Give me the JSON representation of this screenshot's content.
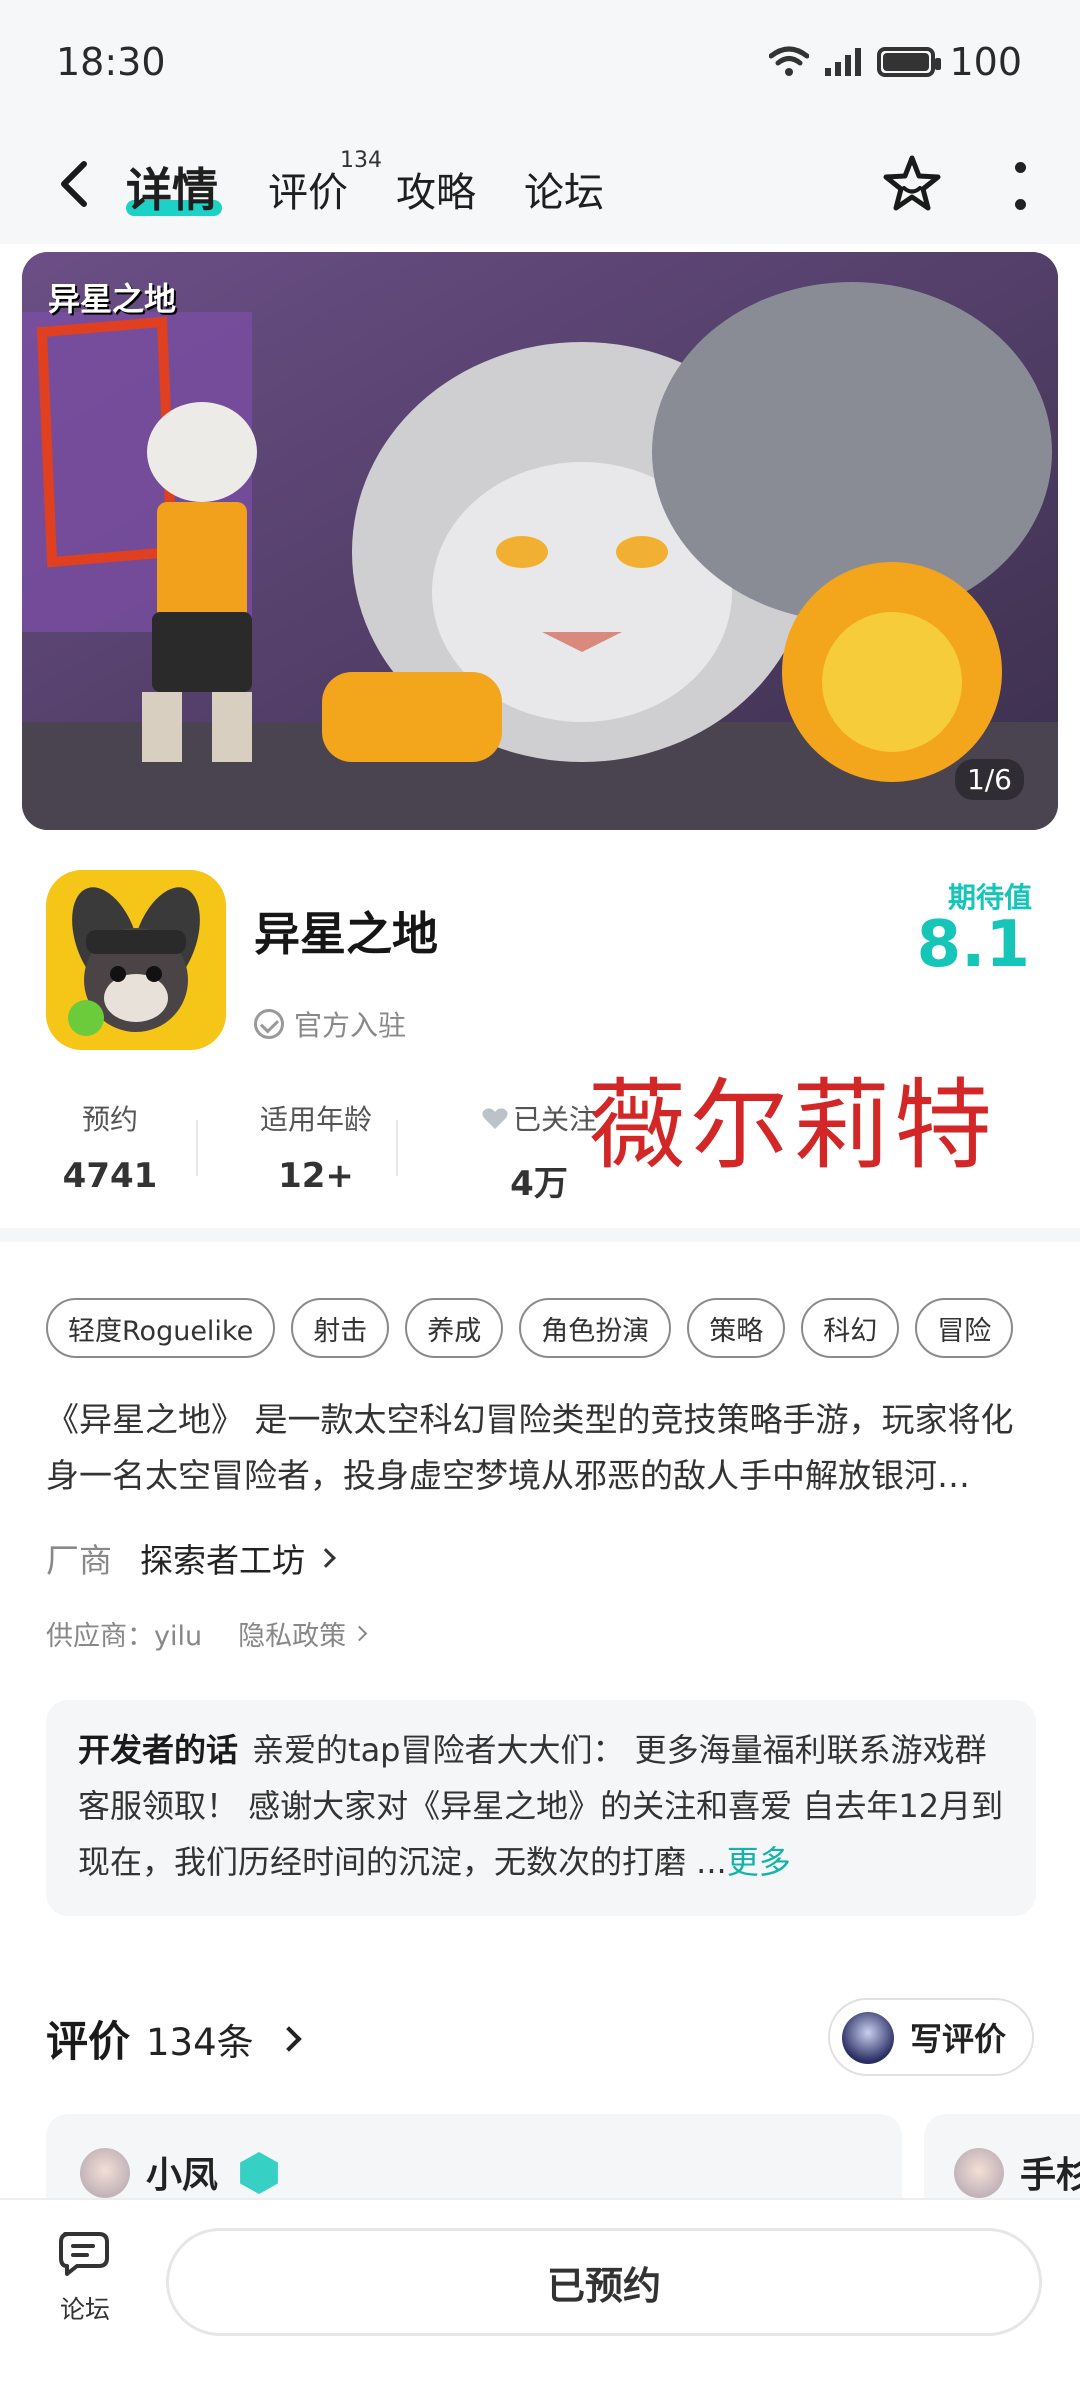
{
  "status_bar": {
    "time": "18:30",
    "battery": "100"
  },
  "nav": {
    "tabs": [
      {
        "label": "详情",
        "active": true
      },
      {
        "label": "评价",
        "badge": "134"
      },
      {
        "label": "攻略"
      },
      {
        "label": "论坛"
      }
    ],
    "icons": [
      "back-icon",
      "star-icon",
      "more-icon"
    ]
  },
  "banner": {
    "logo": "异星之地",
    "counter": "1/6"
  },
  "app": {
    "name": "异星之地",
    "official": "官方入驻",
    "expect_label": "期待值",
    "expect_value": "8.1"
  },
  "stats": [
    {
      "label": "预约",
      "value": "4741"
    },
    {
      "label": "适用年龄",
      "value": "12+"
    },
    {
      "label": "已关注",
      "value": "4万"
    }
  ],
  "watermark": "薇尔莉特",
  "tags": [
    "轻度Roguelike",
    "射击",
    "养成",
    "角色扮演",
    "策略",
    "科幻",
    "冒险"
  ],
  "description": "《异星之地》 是一款太空科幻冒险类型的竞技策略手游，玩家将化身一名太空冒险者，投身虚空梦境从邪恶的敌人手中解放银河…",
  "vendor": {
    "label": "厂商",
    "name": "探索者工坊"
  },
  "supplier": {
    "text": "供应商：yilu",
    "privacy": "隐私政策"
  },
  "developer": {
    "label": "开发者的话",
    "text": "亲爱的tap冒险者大大们： 更多海量福利联系游戏群客服领取！ 感谢大家对《异星之地》的关注和喜爱 自去年12月到现在，我们历经时间的沉淀，无数次的打磨 ...",
    "more": "更多"
  },
  "reviews": {
    "title": "评价",
    "count": "134条",
    "write_label": "写评价",
    "cards": [
      {
        "name": "小凤"
      },
      {
        "name": "手杉"
      }
    ]
  },
  "bottom": {
    "forum_label": "论坛",
    "reserve_label": "已预约"
  },
  "colors": {
    "accent": "#14c5b8",
    "watermark": "#d32626"
  }
}
